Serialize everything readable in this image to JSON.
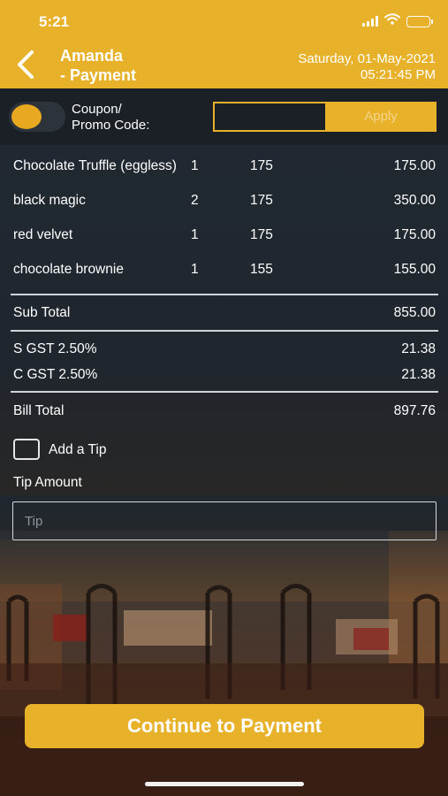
{
  "status_bar": {
    "time": "5:21",
    "icons": [
      "signal-icon",
      "wifi-icon",
      "battery-icon"
    ]
  },
  "header": {
    "title_line1": "Amanda",
    "title_line2": "- Payment",
    "date": "Saturday, 01-May-2021",
    "time": "05:21:45 PM",
    "back_icon": "chevron-left-icon"
  },
  "coupon": {
    "label_line1": "Coupon/",
    "label_line2": "Promo Code:",
    "input_value": "",
    "apply_label": "Apply"
  },
  "items": [
    {
      "name": "Chocolate Truffle (eggless)",
      "qty": "1",
      "price": "175",
      "amount": "175.00"
    },
    {
      "name": "black magic",
      "qty": "2",
      "price": "175",
      "amount": "350.00"
    },
    {
      "name": "red velvet",
      "qty": "1",
      "price": "175",
      "amount": "175.00"
    },
    {
      "name": "chocolate brownie",
      "qty": "1",
      "price": "155",
      "amount": "155.00"
    }
  ],
  "summary": {
    "subtotal_label": "Sub Total",
    "subtotal_value": "855.00",
    "sgst_label": "S GST 2.50%",
    "sgst_value": "21.38",
    "cgst_label": "C GST 2.50%",
    "cgst_value": "21.38",
    "bill_total_label": "Bill Total",
    "bill_total_value": "897.76"
  },
  "tip": {
    "checkbox_label": "Add a Tip",
    "amount_label": "Tip Amount",
    "placeholder": "Tip"
  },
  "continue_label": "Continue to Payment",
  "colors": {
    "accent": "#e8b12a",
    "background": "#1f262e"
  }
}
